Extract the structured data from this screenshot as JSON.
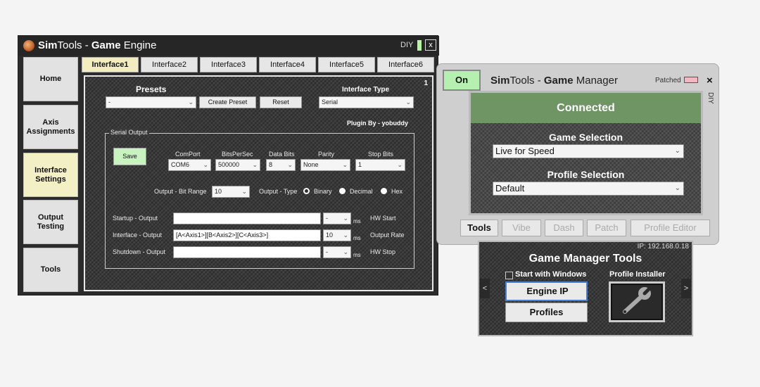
{
  "engine": {
    "title_bold1": "Sim",
    "title_mid": "Tools - ",
    "title_bold2": "Game",
    "title_end": " Engine",
    "diy": "DIY",
    "close": "x",
    "sidebar": [
      {
        "label": "Home"
      },
      {
        "label": "Axis Assignments"
      },
      {
        "label": "Interface Settings"
      },
      {
        "label": "Output Testing"
      },
      {
        "label": "Tools"
      }
    ],
    "tabs": [
      "Interface1",
      "Interface2",
      "Interface3",
      "Interface4",
      "Interface5",
      "Interface6"
    ],
    "panel_number": "1",
    "presets_label": "Presets",
    "presets_value": "-",
    "create_preset": "Create Preset",
    "reset": "Reset",
    "interface_type_label": "Interface Type",
    "interface_type_value": "Serial",
    "plugin_by": "Plugin By - yobuddy",
    "serial_group_label": "Serial Output",
    "save": "Save",
    "comport_label": "ComPort",
    "comport_value": "COM6",
    "bps_label": "BitsPerSec",
    "bps_value": "500000",
    "databits_label": "Data Bits",
    "databits_value": "8",
    "parity_label": "Parity",
    "parity_value": "None",
    "stopbits_label": "Stop Bits",
    "stopbits_value": "1",
    "bitrange_label": "Output - Bit Range",
    "bitrange_value": "10",
    "outtype_label": "Output - Type",
    "type_binary": "Binary",
    "type_decimal": "Decimal",
    "type_hex": "Hex",
    "startup_label": "Startup - Output",
    "startup_value": "",
    "startup_ms": "-",
    "hw_start": "HW Start",
    "interface_label": "Interface - Output",
    "interface_value": "[A<Axis1>][B<Axis2>][C<Axis3>]",
    "interface_ms": "10",
    "output_rate": "Output Rate",
    "shutdown_label": "Shutdown - Output",
    "shutdown_value": "",
    "shutdown_ms": "-",
    "hw_stop": "HW Stop",
    "ms": "ms"
  },
  "manager": {
    "on": "On",
    "title_bold1": "Sim",
    "title_mid": "Tools - ",
    "title_bold2": "Game",
    "title_end": " Manager",
    "patched": "Patched",
    "close": "×",
    "diy": "DIY",
    "status": "Connected",
    "game_selection_label": "Game Selection",
    "game_selection_value": "Live for Speed",
    "profile_selection_label": "Profile Selection",
    "profile_selection_value": "Default",
    "tabs": [
      "Tools",
      "Vibe",
      "Dash",
      "Patch",
      "Profile Editor"
    ]
  },
  "tools": {
    "ip": "IP: 192.168.0.18",
    "title": "Game Manager Tools",
    "start_with_windows": "Start with Windows",
    "profile_installer": "Profile Installer",
    "engine_ip": "Engine IP",
    "profiles": "Profiles",
    "left_arrow": "<",
    "right_arrow": ">"
  },
  "colors": {
    "connected_green": "#6f9565",
    "on_green": "#b6f0b0",
    "active_tab": "#f2ecc0",
    "patched_led": "#f1b8c0"
  }
}
